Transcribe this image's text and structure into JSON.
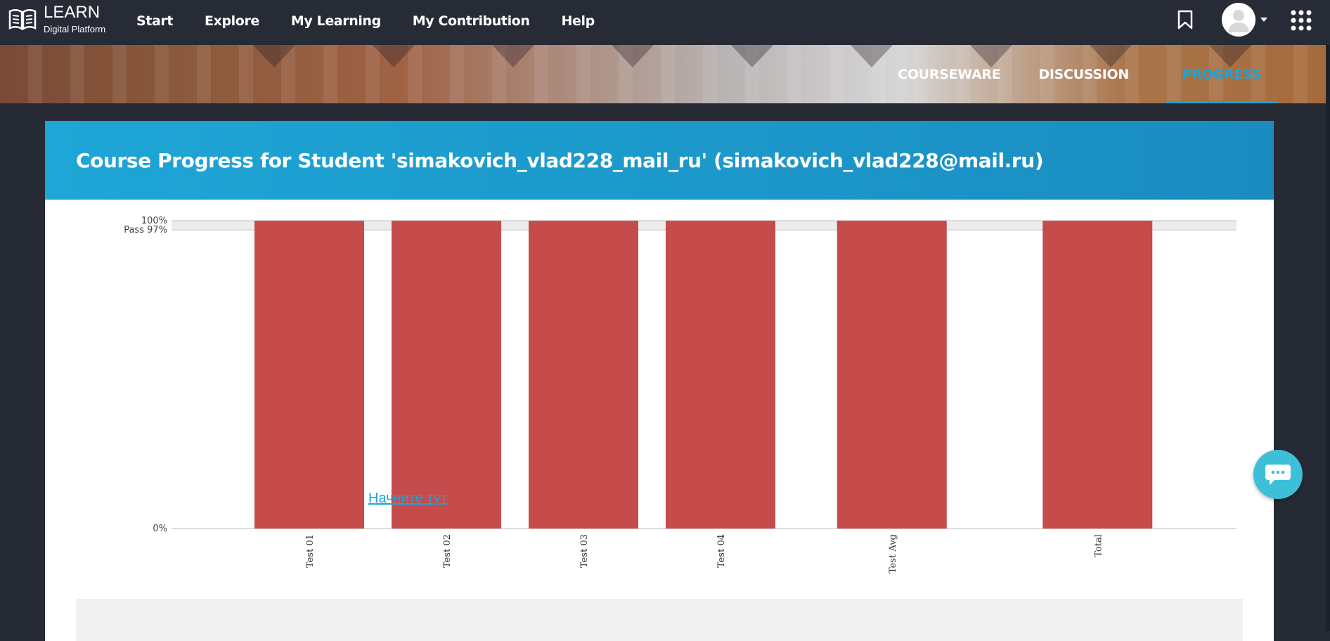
{
  "brand": {
    "title": "LEARN",
    "subtitle": "Digital Platform"
  },
  "nav": [
    {
      "label": "Start"
    },
    {
      "label": "Explore"
    },
    {
      "label": "My Learning"
    },
    {
      "label": "My Contribution"
    },
    {
      "label": "Help"
    }
  ],
  "icons": {
    "bookmark": "bookmark-icon",
    "avatar": "avatar",
    "apps": "apps-grid-icon",
    "chat": "chat-icon"
  },
  "tabs": [
    {
      "label": "COURSEWARE",
      "active": false
    },
    {
      "label": "DISCUSSION",
      "active": false
    },
    {
      "label": "PROGRESS",
      "active": true
    }
  ],
  "page": {
    "title": "Course Progress for Student 'simakovich_vlad228_mail_ru' (simakovich_vlad228@mail.ru)"
  },
  "colors": {
    "bar": "#c64c4c",
    "accent": "#1ea3d6",
    "header": "#1a98cc"
  },
  "chart_data": {
    "type": "bar",
    "categories": [
      "Test 01",
      "Test 02",
      "Test 03",
      "Test 04",
      "Test Avg",
      "Total"
    ],
    "values": [
      100,
      100,
      100,
      100,
      100,
      100
    ],
    "ylim": [
      0,
      100
    ],
    "y_ticks": [
      {
        "value": 100,
        "label": "100%"
      },
      {
        "value": 97,
        "label": "Pass 97%"
      },
      {
        "value": 0,
        "label": "0%"
      }
    ]
  },
  "bottom": {
    "link_text": "Начните тут"
  }
}
